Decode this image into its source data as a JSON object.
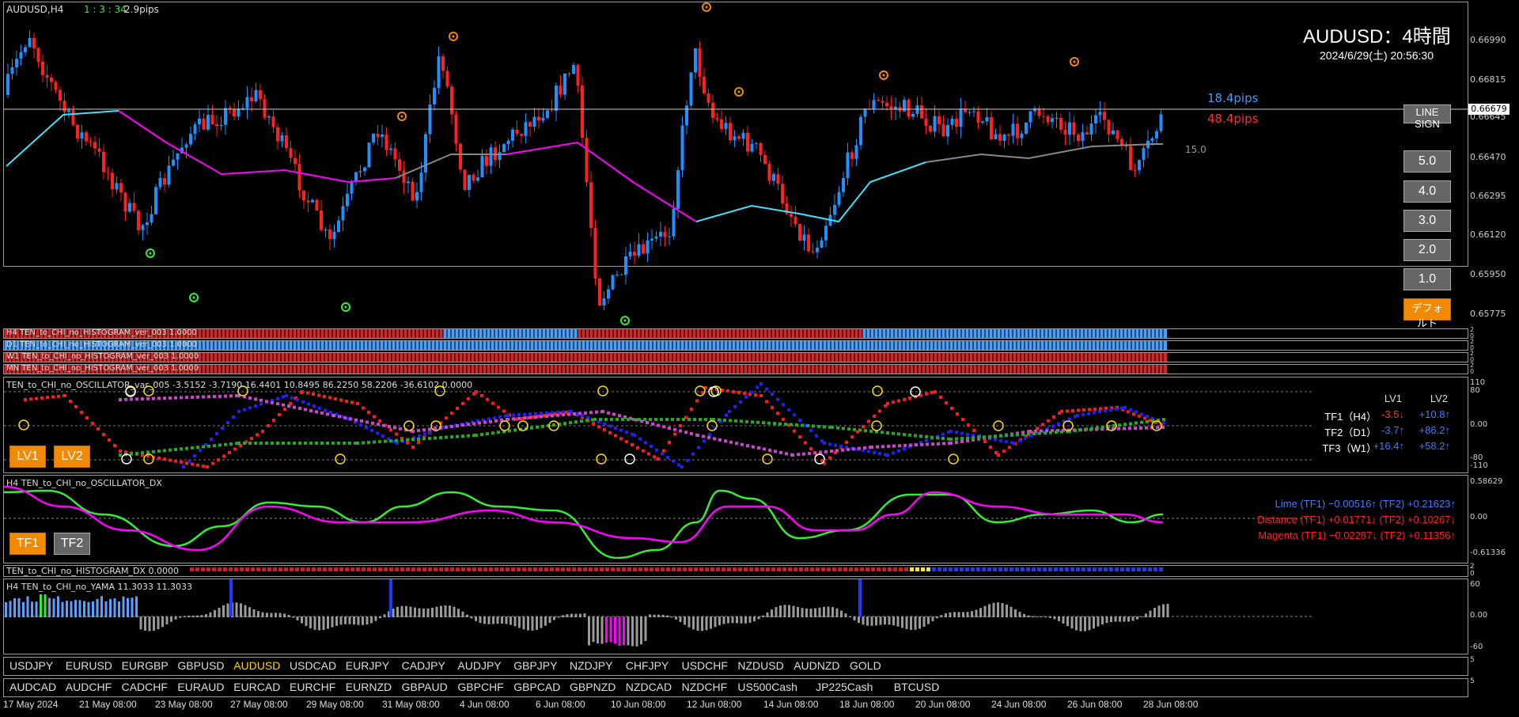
{
  "header": {
    "symbol_tf": "AUDUSD,H4",
    "timer": "1 : 3 : 34",
    "spread": "2.9pips"
  },
  "title": {
    "main": "AUDUSD：4時間",
    "datetime": "2024/6/29(土) 20:56:30"
  },
  "pips": {
    "blue": "18.4pips",
    "red": "48.4pips",
    "gray": "15.0"
  },
  "price_axis": [
    "0.66990",
    "0.66815",
    "0.66645",
    "0.66470",
    "0.66295",
    "0.66120",
    "0.65950",
    "0.65775"
  ],
  "current_price": "0.66679",
  "side_buttons": {
    "line_sign": "LINE SIGN",
    "levels": [
      "5.0",
      "4.0",
      "3.0",
      "2.0",
      "1.0"
    ],
    "default": "デフォルト"
  },
  "histograms": [
    {
      "label": "H4 TEN_to_CHI_no_HISTOGRAM_ver_003 1.0000",
      "scale_top": "2",
      "scale_bottom": "0"
    },
    {
      "label": "D1 TEN_to_CHI_no_HISTOGRAM_ver_003 1.0000",
      "scale_top": "2",
      "scale_bottom": "0"
    },
    {
      "label": "W1 TEN_to_CHI_no_HISTOGRAM_ver_003 1.0000",
      "scale_top": "2",
      "scale_bottom": "0"
    },
    {
      "label": "MN TEN_to_CHI_no_HISTOGRAM_ver_003 1.0000",
      "scale_top": "2",
      "scale_bottom": "0"
    }
  ],
  "oscillator": {
    "label": "TEN_to_CHI_no_OSCILLATOR_var_005 -3.5152 -3.7190 16.4401 10.8495 86.2250 58.2206 -36.6102 0.0000",
    "scale": [
      "110",
      "80",
      "0.00",
      "-80",
      "-110"
    ],
    "buttons": {
      "lv1": "LV1",
      "lv2": "LV2"
    },
    "table": {
      "headers": [
        "LV1",
        "LV2"
      ],
      "rows": [
        {
          "tf": "TF1（H4）",
          "lv1": "-3.5↓",
          "lv2": "+10.8↑",
          "lv1_color": "#ff3030",
          "lv2_color": "#3d7bff"
        },
        {
          "tf": "TF2（D1）",
          "lv1": "-3.7↑",
          "lv2": "+86.2↑",
          "lv1_color": "#3d7bff",
          "lv2_color": "#3d7bff"
        },
        {
          "tf": "TF3（W1）",
          "lv1": "+16.4↑",
          "lv2": "+58.2↑",
          "lv1_color": "#3d7bff",
          "lv2_color": "#3d7bff"
        }
      ]
    }
  },
  "dx": {
    "label": "H4 TEN_to_CHI_no_OSCILLATOR_DX",
    "scale": [
      "0.58629",
      "0.00",
      "-0.61336"
    ],
    "buttons": {
      "tf1": "TF1",
      "tf2": "TF2"
    },
    "lines": [
      "Lime (TF1) −0.00516↑ (TF2) +0.21623↑",
      "Distance (TF1) +0.01771↓ (TF2) +0.10267↓",
      "Magenta (TF1) −0.02287↓ (TF2) +0.11356↑"
    ]
  },
  "histogram_dx": {
    "label": "TEN_to_CHI_no_HISTOGRAM_DX 0.0000",
    "scale_top": "2",
    "scale_bottom": "0"
  },
  "yama": {
    "label": "H4 TEN_to_CHI_no_YAMA 11.3033 11.3033",
    "scale": [
      "60",
      "0.00",
      "-60"
    ]
  },
  "symbols_row1": [
    "USDJPY",
    "EURUSD",
    "EURGBP",
    "GBPUSD",
    "AUDUSD",
    "USDCAD",
    "EURJPY",
    "CADJPY",
    "AUDJPY",
    "GBPJPY",
    "NZDJPY",
    "CHFJPY",
    "USDCHF",
    "NZDUSD",
    "AUDNZD",
    "GOLD"
  ],
  "symbols_row2": [
    "AUDCAD",
    "AUDCHF",
    "CADCHF",
    "EURAUD",
    "EURCAD",
    "EURCHF",
    "EURNZD",
    "GBPAUD",
    "GBPCHF",
    "GBPCAD",
    "GBPNZD",
    "NZDCAD",
    "NZDCHF",
    "US500Cash",
    "JP225Cash",
    "BTCUSD"
  ],
  "active_symbol": "AUDUSD",
  "time_axis": [
    "17 May 2024",
    "21 May 08:00",
    "23 May 08:00",
    "27 May 08:00",
    "29 May 08:00",
    "31 May 08:00",
    "4 Jun 08:00",
    "6 Jun 08:00",
    "10 Jun 08:00",
    "12 Jun 08:00",
    "14 Jun 08:00",
    "18 Jun 08:00",
    "20 Jun 08:00",
    "24 Jun 08:00",
    "26 Jun 08:00",
    "28 Jun 08:00"
  ],
  "colors": {
    "bull": "#1e90ff",
    "bear": "#ff2020",
    "cyan": "#40e0ff",
    "magenta": "#ff00ff",
    "lime": "#33ee33",
    "orange": "#f28a00"
  }
}
